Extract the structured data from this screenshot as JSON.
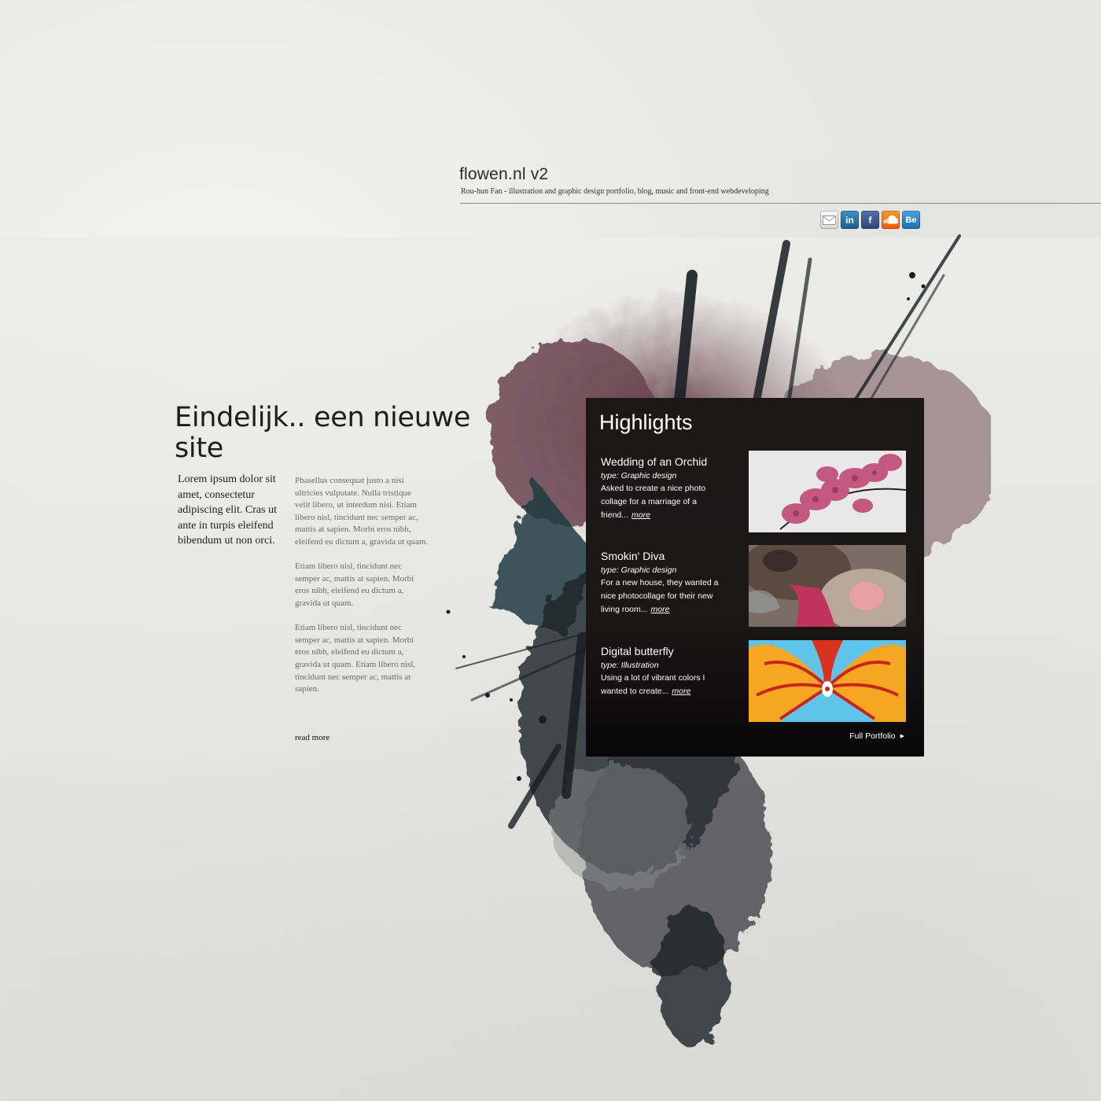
{
  "header": {
    "title": "flowen.nl v2",
    "subtitle": "Rou-hun Fan - illustration and graphic design portfolio, blog, music and front-end webdeveloping"
  },
  "social": [
    {
      "name": "mail-icon",
      "label": ""
    },
    {
      "name": "linkedin-icon",
      "label": "in"
    },
    {
      "name": "facebook-icon",
      "label": "f"
    },
    {
      "name": "soundcloud-icon",
      "label": ""
    },
    {
      "name": "behance-icon",
      "label": "Be"
    }
  ],
  "main": {
    "headline": "Eindelijk.. een nieuwe site",
    "intro": "Lorem ipsum dolor sit amet, consectetur adipiscing elit. Cras ut ante in turpis eleifend bibendum ut non orci.",
    "paragraphs": [
      "Phasellus consequat justo a nisi ultricies vulputate. Nulla tristique velit libero, ut interdum nisi. Etiam libero nisl, tincidunt nec semper ac, mattis at sapien. Morbi eros nibh, eleifend eu dictum a, gravida ut quam.",
      "Etiam libero nisl, tincidunt nec semper ac, mattis at sapien. Morbi eros nibh, eleifend eu dictum a, gravida ut quam.",
      "Etiam libero nisl, tincidunt nec semper ac, mattis at sapien. Morbi eros nibh, eleifend eu dictum a, gravida ut quam. Etiam libero nisl, tincidunt nec semper ac, mattis at sapien."
    ],
    "read_more": "read more"
  },
  "highlights": {
    "title": "Highlights",
    "items": [
      {
        "title": "Wedding of an Orchid",
        "type": "type: Graphic design",
        "desc": "Asked to create a nice photo collage for a marriage of a friend...",
        "more": "more"
      },
      {
        "title": "Smokin' Diva",
        "type": "type: Graphic design",
        "desc": "For a new house, they wanted a nice photocollage for their new living room...",
        "more": "more"
      },
      {
        "title": "Digital butterfly",
        "type": "type: Illustration",
        "desc": "Using a lot of vibrant colors I wanted to create...",
        "more": "more"
      }
    ],
    "full_portfolio": "Full Portfolio",
    "arrow": "▶"
  },
  "colors": {
    "background": "#e6e6e3",
    "panel": "#1a1717",
    "splatter_maroon": "#5e3a45",
    "splatter_dark": "#1c2228",
    "splatter_teal": "#1f3b3f"
  }
}
